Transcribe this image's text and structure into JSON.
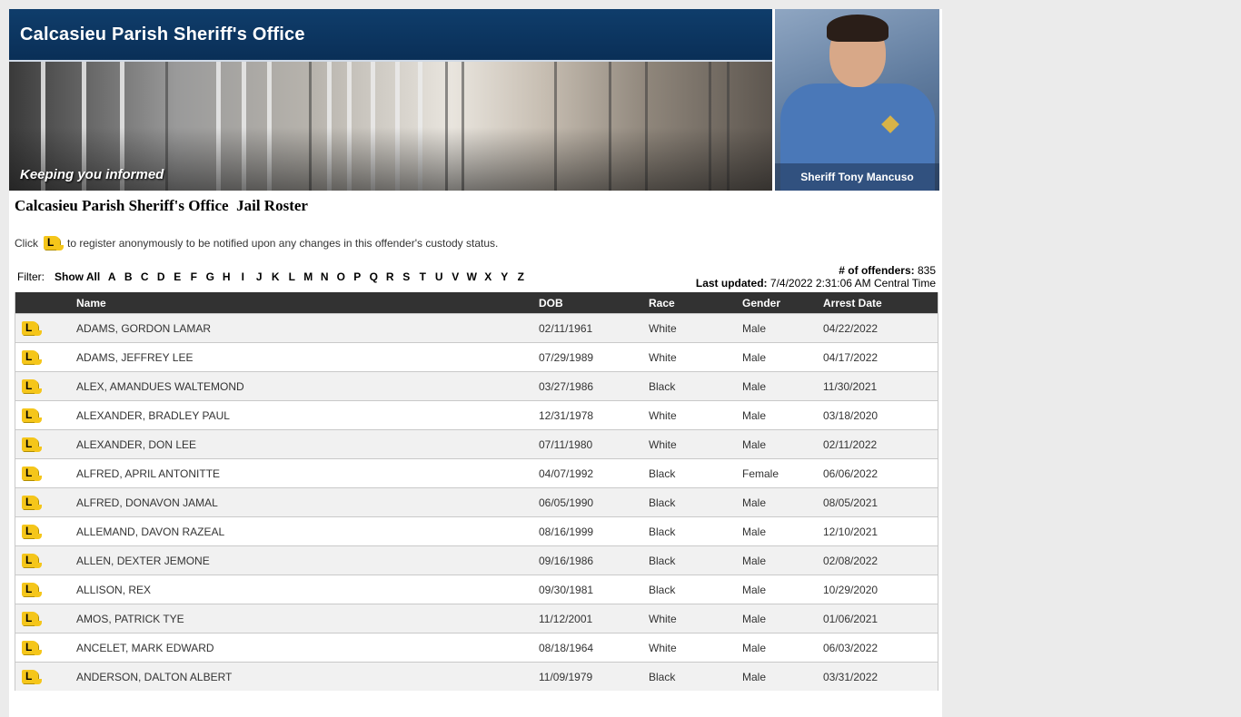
{
  "header": {
    "title": "Calcasieu Parish Sheriff's Office",
    "tagline": "Keeping you informed",
    "sheriff_caption": "Sheriff Tony Mancuso"
  },
  "page": {
    "roster_title": "Calcasieu Parish Sheriff's Office  Jail Roster",
    "notice_prefix": "Click",
    "notice_suffix": "to register anonymously to be notified upon any changes in this offender's custody status."
  },
  "filter": {
    "label": "Filter:",
    "show_all": "Show All",
    "letters": [
      "A",
      "B",
      "C",
      "D",
      "E",
      "F",
      "G",
      "H",
      "I",
      "J",
      "K",
      "L",
      "M",
      "N",
      "O",
      "P",
      "Q",
      "R",
      "S",
      "T",
      "U",
      "V",
      "W",
      "X",
      "Y",
      "Z"
    ]
  },
  "stats": {
    "count_label": "# of offenders:",
    "count": "835",
    "updated_label": "Last updated:",
    "updated": "7/4/2022 2:31:06 AM Central Time"
  },
  "table": {
    "columns": [
      "",
      "Name",
      "DOB",
      "Race",
      "Gender",
      "Arrest Date"
    ],
    "rows": [
      {
        "name": "ADAMS, GORDON LAMAR",
        "dob": "02/11/1961",
        "race": "White",
        "gender": "Male",
        "arrest": "04/22/2022"
      },
      {
        "name": "ADAMS, JEFFREY LEE",
        "dob": "07/29/1989",
        "race": "White",
        "gender": "Male",
        "arrest": "04/17/2022"
      },
      {
        "name": "ALEX, AMANDUES WALTEMOND",
        "dob": "03/27/1986",
        "race": "Black",
        "gender": "Male",
        "arrest": "11/30/2021"
      },
      {
        "name": "ALEXANDER, BRADLEY PAUL",
        "dob": "12/31/1978",
        "race": "White",
        "gender": "Male",
        "arrest": "03/18/2020"
      },
      {
        "name": "ALEXANDER, DON LEE",
        "dob": "07/11/1980",
        "race": "White",
        "gender": "Male",
        "arrest": "02/11/2022"
      },
      {
        "name": "ALFRED, APRIL ANTONITTE",
        "dob": "04/07/1992",
        "race": "Black",
        "gender": "Female",
        "arrest": "06/06/2022"
      },
      {
        "name": "ALFRED, DONAVON JAMAL",
        "dob": "06/05/1990",
        "race": "Black",
        "gender": "Male",
        "arrest": "08/05/2021"
      },
      {
        "name": "ALLEMAND, DAVON RAZEAL",
        "dob": "08/16/1999",
        "race": "Black",
        "gender": "Male",
        "arrest": "12/10/2021"
      },
      {
        "name": "ALLEN, DEXTER JEMONE",
        "dob": "09/16/1986",
        "race": "Black",
        "gender": "Male",
        "arrest": "02/08/2022"
      },
      {
        "name": "ALLISON, REX",
        "dob": "09/30/1981",
        "race": "Black",
        "gender": "Male",
        "arrest": "10/29/2020"
      },
      {
        "name": "AMOS, PATRICK TYE",
        "dob": "11/12/2001",
        "race": "White",
        "gender": "Male",
        "arrest": "01/06/2021"
      },
      {
        "name": "ANCELET, MARK EDWARD",
        "dob": "08/18/1964",
        "race": "White",
        "gender": "Male",
        "arrest": "06/03/2022"
      },
      {
        "name": "ANDERSON, DALTON ALBERT",
        "dob": "11/09/1979",
        "race": "Black",
        "gender": "Male",
        "arrest": "03/31/2022"
      }
    ]
  }
}
